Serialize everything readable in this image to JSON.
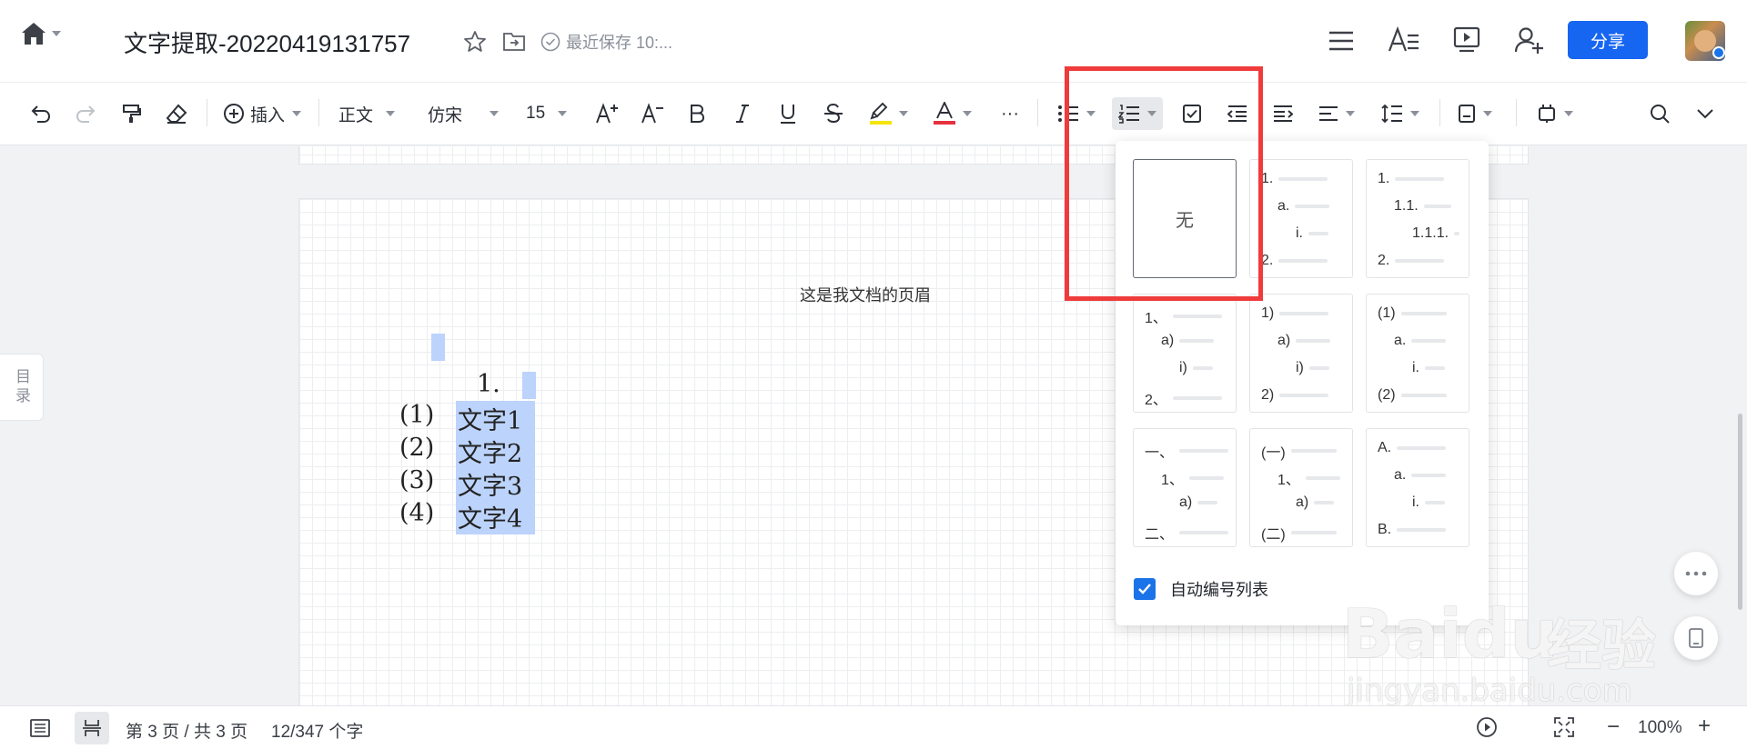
{
  "header": {
    "doc_title": "文字提取-20220419131757",
    "save_status": "最近保存 10:...",
    "share_label": "分享"
  },
  "toolbar": {
    "insert_label": "插入",
    "style_label": "正文",
    "font_label": "仿宋",
    "size_label": "15",
    "more_label": "···",
    "highlight_color": "#f5e50a",
    "font_color": "#e5323e"
  },
  "sidebar": {
    "toc_label": "目录"
  },
  "document": {
    "header_text": "这是我文档的页眉",
    "heading_number": "1.",
    "items": [
      {
        "num": "(1)",
        "text": "文字1"
      },
      {
        "num": "(2)",
        "text": "文字2"
      },
      {
        "num": "(3)",
        "text": "文字3"
      },
      {
        "num": "(4)",
        "text": "文字4"
      }
    ]
  },
  "numbering_panel": {
    "none_label": "无",
    "options": [
      {
        "lines": [
          "1.",
          "a.",
          "i.",
          "2."
        ]
      },
      {
        "lines": [
          "1.",
          "1.1.",
          "1.1.1.",
          "2."
        ]
      },
      {
        "lines": [
          "1、",
          "a)",
          "i)",
          "2、"
        ]
      },
      {
        "lines": [
          "1)",
          "a)",
          "i)",
          "2)"
        ]
      },
      {
        "lines": [
          "(1)",
          "a.",
          "i.",
          "(2)"
        ]
      },
      {
        "lines": [
          "一、",
          "1、",
          "a)",
          "二、"
        ]
      },
      {
        "lines": [
          "(一)",
          "1、",
          "a)",
          "(二)"
        ]
      },
      {
        "lines": [
          "A.",
          "a.",
          "i.",
          "B."
        ]
      }
    ],
    "auto_number_label": "自动编号列表",
    "auto_number_checked": true
  },
  "statusbar": {
    "page_info": "第 3 页 / 共 3 页",
    "word_count": "12/347 个字",
    "zoom": "100%",
    "zoom_minus": "−",
    "zoom_plus": "+"
  },
  "watermark": {
    "brand": "Baidu",
    "brand_suffix": "经验",
    "url": "jingyan.baidu.com"
  },
  "colors": {
    "accent": "#1a73e8",
    "share_button": "#1766f2",
    "annotation_box": "#ef3b3b",
    "selection": "#bcd3fb"
  },
  "icons": [
    "home-icon",
    "star-icon",
    "move-folder-icon",
    "saved-check-icon",
    "menu-icon",
    "text-style-icon",
    "present-icon",
    "add-collaborator-icon",
    "undo-icon",
    "redo-icon",
    "format-painter-icon",
    "eraser-icon",
    "search-icon"
  ]
}
